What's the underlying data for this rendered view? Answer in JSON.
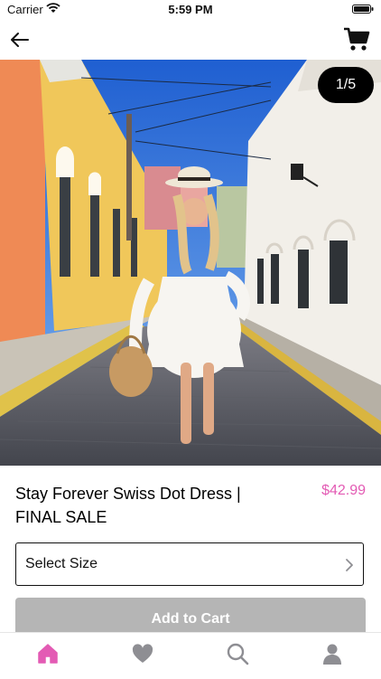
{
  "status_bar": {
    "carrier": "Carrier",
    "time": "5:59 PM"
  },
  "nav": {
    "back_icon": "arrow-left-icon",
    "cart_icon": "cart-icon"
  },
  "gallery": {
    "counter": "1/5"
  },
  "product": {
    "title": "Stay Forever Swiss Dot Dress | FINAL SALE",
    "price": "$42.99"
  },
  "size_select": {
    "label": "Select Size"
  },
  "add_to_cart": {
    "label": "Add to Cart"
  },
  "tabs": [
    {
      "name": "home",
      "icon": "home-icon",
      "active": true
    },
    {
      "name": "favorites",
      "icon": "heart-icon",
      "active": false
    },
    {
      "name": "search",
      "icon": "search-icon",
      "active": false
    },
    {
      "name": "profile",
      "icon": "person-icon",
      "active": false
    }
  ],
  "colors": {
    "accent": "#e35bb4",
    "tab_inactive": "#8e8e93",
    "button_disabled": "#b5b5b5"
  }
}
